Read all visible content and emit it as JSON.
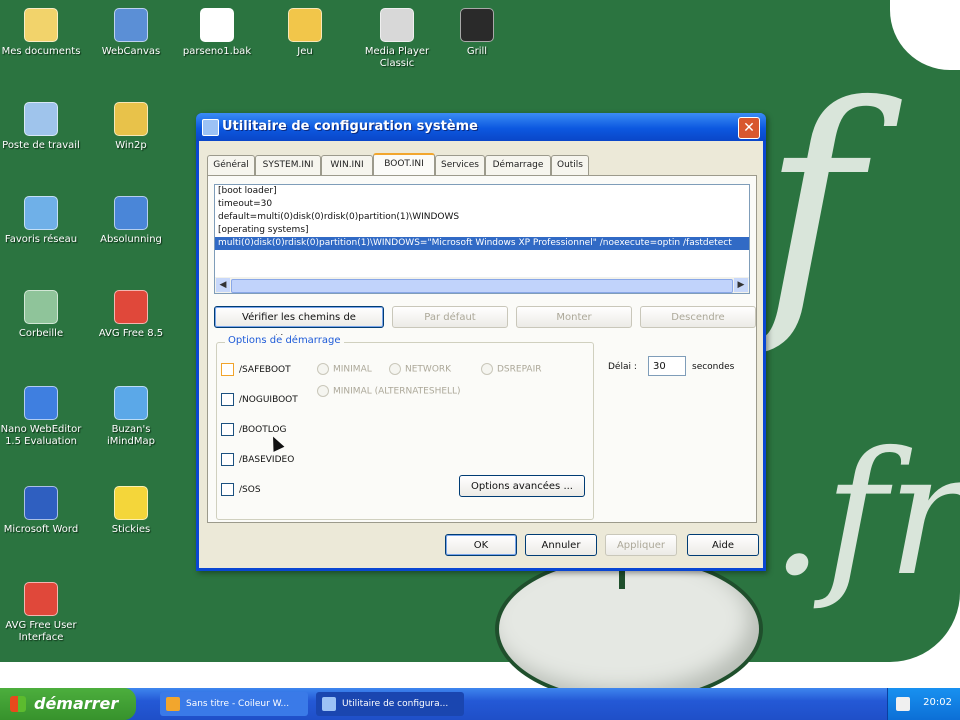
{
  "desktop": {
    "icons": [
      {
        "label": "Mes documents",
        "color": "#f2d36b",
        "icon": "folder-documents-icon"
      },
      {
        "label": "WebCanvas",
        "color": "#5b8fd6",
        "icon": "webcanvas-icon"
      },
      {
        "label": "parseno1.bak",
        "color": "#ffffff",
        "icon": "text-file-icon"
      },
      {
        "label": "Jeu",
        "color": "#f2c64a",
        "icon": "folder-icon"
      },
      {
        "label": "Media Player Classic",
        "color": "#d8d8d8",
        "icon": "media-player-icon"
      },
      {
        "label": "Grill",
        "color": "#2a2a2a",
        "icon": "grill-icon"
      },
      {
        "label": "Poste de travail",
        "color": "#9fc4ec",
        "icon": "computer-icon"
      },
      {
        "label": "Win2p",
        "color": "#e8c24a",
        "icon": "archive-icon"
      },
      {
        "label": "Favoris réseau",
        "color": "#6fb0e8",
        "icon": "network-icon"
      },
      {
        "label": "Absolunning",
        "color": "#4a86d8",
        "icon": "shortcut-icon"
      },
      {
        "label": "Corbeille",
        "color": "#8fc49a",
        "icon": "recycle-bin-icon"
      },
      {
        "label": "AVG Free 8.5",
        "color": "#e0483a",
        "icon": "avg-icon"
      },
      {
        "label": "Nano WebEditor 1.5 Evaluation",
        "color": "#3f7fe0",
        "icon": "editor-icon"
      },
      {
        "label": "Buzan's iMindMap",
        "color": "#5ba8e8",
        "icon": "mindmap-icon"
      },
      {
        "label": "Microsoft Word",
        "color": "#2f5fc0",
        "icon": "word-icon"
      },
      {
        "label": "Stickies",
        "color": "#f4d63a",
        "icon": "stickies-icon"
      },
      {
        "label": "AVG Free User Interface",
        "color": "#e0483a",
        "icon": "avg-icon"
      }
    ],
    "watermark": "f",
    "watermark_tld": ".fr"
  },
  "dialog": {
    "title": "Utilitaire de configuration système",
    "close": "✕",
    "tabs": [
      "Général",
      "SYSTEM.INI",
      "WIN.INI",
      "BOOT.INI",
      "Services",
      "Démarrage",
      "Outils"
    ],
    "active_tab": "BOOT.INI",
    "boot_ini_lines": [
      "[boot loader]",
      "timeout=30",
      "default=multi(0)disk(0)rdisk(0)partition(1)\\WINDOWS",
      "[operating systems]",
      "multi(0)disk(0)rdisk(0)partition(1)\\WINDOWS=\"Microsoft Windows XP Professionnel\" /noexecute=optin /fastdetect"
    ],
    "selected_line_index": 4,
    "buttons_row": {
      "check": "Vérifier les chemins de démarrage",
      "default": "Par défaut",
      "up": "Monter",
      "down": "Descendre"
    },
    "boot_options": {
      "legend": "Options de démarrage",
      "checkboxes": [
        "/SAFEBOOT",
        "/NOGUIBOOT",
        "/BOOTLOG",
        "/BASEVIDEO",
        "/SOS"
      ],
      "radios": [
        "MINIMAL",
        "NETWORK",
        "DSREPAIR",
        "MINIMAL (ALTERNATESHELL)"
      ],
      "advanced": "Options avancées ..."
    },
    "delay": {
      "label": "Délai :",
      "value": "30",
      "unit": "secondes"
    },
    "footer": {
      "ok": "OK",
      "cancel": "Annuler",
      "apply": "Appliquer",
      "help": "Aide"
    }
  },
  "taskbar": {
    "start": "démarrer",
    "tasks": [
      {
        "label": "Sans titre - Coileur W...",
        "color": "#f2a62d",
        "icon": "paint-icon"
      },
      {
        "label": "Utilitaire de configura...",
        "color": "#9cc2f5",
        "icon": "msconfig-icon"
      }
    ],
    "clock": "20:02"
  }
}
